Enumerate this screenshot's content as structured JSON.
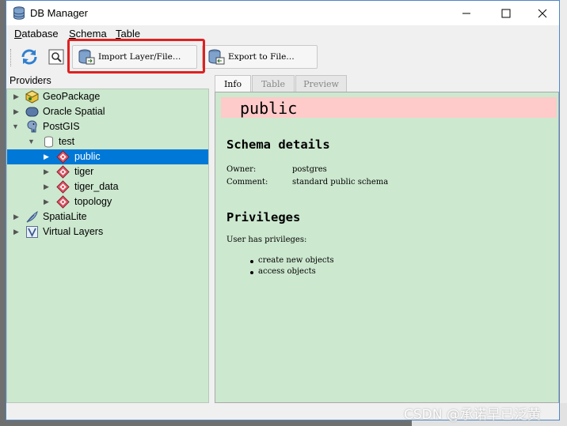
{
  "window": {
    "title": "DB Manager"
  },
  "menu": {
    "items": [
      "Database",
      "Schema",
      "Table"
    ]
  },
  "toolbar": {
    "refresh_icon": "refresh-icon",
    "sql_icon": "sql-window-icon",
    "import_label": "Import Layer/File…",
    "export_label": "Export to File…"
  },
  "providers": {
    "label": "Providers",
    "items": [
      {
        "label": "GeoPackage",
        "icon": "geopackage-icon"
      },
      {
        "label": "Oracle Spatial",
        "icon": "oracle-icon"
      },
      {
        "label": "PostGIS",
        "icon": "postgis-elephant-icon"
      },
      {
        "label": "test",
        "icon": "database-icon"
      },
      {
        "label": "public",
        "icon": "schema-icon"
      },
      {
        "label": "tiger",
        "icon": "schema-icon"
      },
      {
        "label": "tiger_data",
        "icon": "schema-icon"
      },
      {
        "label": "topology",
        "icon": "schema-icon"
      },
      {
        "label": "SpatiaLite",
        "icon": "spatialite-feather-icon"
      },
      {
        "label": "Virtual Layers",
        "icon": "virtual-layers-icon"
      }
    ],
    "selected": "public"
  },
  "tabs": [
    "Info",
    "Table",
    "Preview"
  ],
  "info": {
    "schema_name": "public",
    "schema_details_heading": "Schema details",
    "owner_label": "Owner:",
    "owner_value": "postgres",
    "comment_label": "Comment:",
    "comment_value": "standard public schema",
    "privileges_heading": "Privileges",
    "privileges_intro": "User has privileges:",
    "privileges": [
      "create new objects",
      "access objects"
    ]
  },
  "watermark": "CSDN @承诺早已泛黄",
  "colors": {
    "panel_bg": "#cce8cf",
    "selection": "#0078d7",
    "header_bg": "#ffcaca",
    "highlight": "#e02020"
  }
}
